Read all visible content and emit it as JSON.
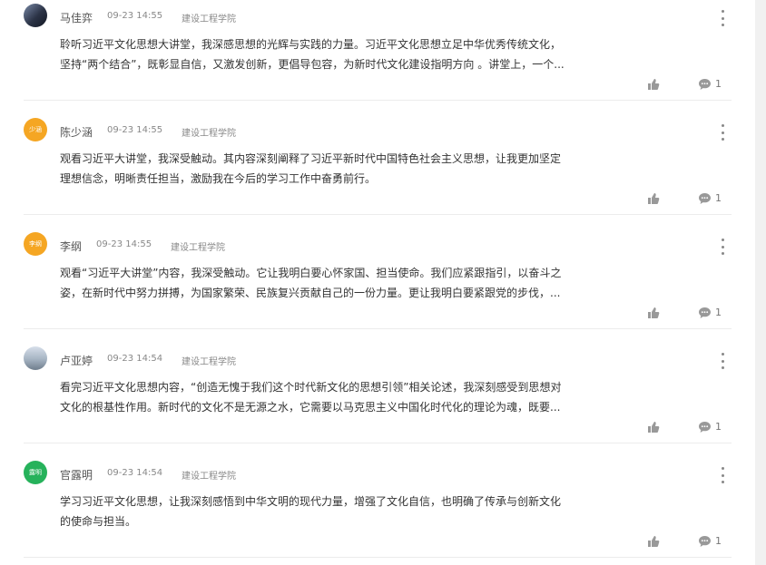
{
  "comments": [
    {
      "name": "马佳弈",
      "time": "09-23 14:55",
      "school": "建设工程学院",
      "avatar_text": "",
      "lines": [
        "聆听习近平文化思想大讲堂，我深感思想的光辉与实践的力量。习近平文化思想立足中华优秀传统文化，",
        "坚持“两个结合”，既彰显自信，又激发创新，更倡导包容，为新时代文化建设指明方向 。讲堂上，一个..."
      ],
      "reply_count": "1"
    },
    {
      "name": "陈少涵",
      "time": "09-23 14:55",
      "school": "建设工程学院",
      "avatar_text": "少涵",
      "lines": [
        "观看习近平大讲堂，我深受触动。其内容深刻阐释了习近平新时代中国特色社会主义思想，让我更加坚定",
        "理想信念，明晰责任担当，激励我在今后的学习工作中奋勇前行。"
      ],
      "reply_count": "1"
    },
    {
      "name": "李纲",
      "time": "09-23 14:55",
      "school": "建设工程学院",
      "avatar_text": "李纲",
      "lines": [
        "观看“习近平大讲堂”内容，我深受触动。它让我明白要心怀家国、担当使命。我们应紧跟指引，以奋斗之",
        "姿，在新时代中努力拼搏，为国家繁荣、民族复兴贡献自己的一份力量。更让我明白要紧跟党的步伐，..."
      ],
      "reply_count": "1"
    },
    {
      "name": "卢亚婷",
      "time": "09-23 14:54",
      "school": "建设工程学院",
      "avatar_text": "",
      "lines": [
        "看完习近平文化思想内容，“创造无愧于我们这个时代新文化的思想引领”相关论述，我深刻感受到思想对",
        "文化的根基性作用。新时代的文化不是无源之水，它需要以马克思主义中国化时代化的理论为魂，既要..."
      ],
      "reply_count": "1"
    },
    {
      "name": "官露明",
      "time": "09-23 14:54",
      "school": "建设工程学院",
      "avatar_text": "露明",
      "lines": [
        "学习习近平文化思想，让我深刻感悟到中华文明的现代力量，增强了文化自信，也明确了传承与创新文化",
        "的使命与担当。"
      ],
      "reply_count": "1"
    }
  ],
  "icons": {
    "like": "thumbs-up-icon",
    "reply": "comment-bubble-icon",
    "menu": "more-vertical-icon"
  },
  "colors": {
    "meta_text": "#888888",
    "icon_gray": "#999999",
    "avatar_orange": "#f5a623",
    "avatar_green": "#26b25b"
  }
}
